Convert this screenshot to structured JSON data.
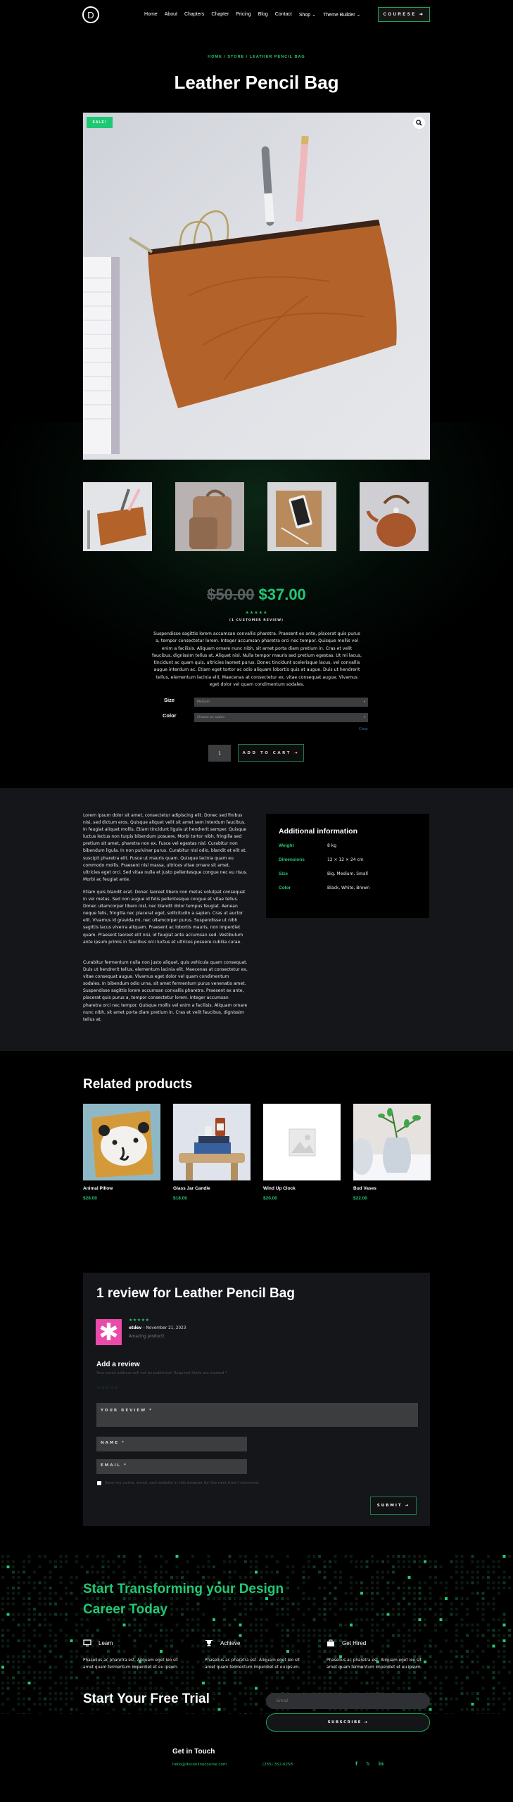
{
  "header": {
    "logo_letter": "D",
    "nav": [
      "Home",
      "About",
      "Chapters",
      "Chapter",
      "Pricing",
      "Blog",
      "Contact",
      "Shop ⌄",
      "Theme Builder ⌄"
    ],
    "course_button": "COURESE ➔"
  },
  "product": {
    "breadcrumb": "HOME / STORE / LEATHER PENCIL BAG",
    "title": "Leather Pencil Bag",
    "sale_badge": "SALE!",
    "zoom_icon": "🔍",
    "thumbnails": [
      "Leather pencil bag",
      "Backpack",
      "Tablet and phone",
      "Copper kettle"
    ],
    "old_price": "$50.00",
    "new_price": "$37.00",
    "rating": 5,
    "rating_stars": "★★★★★",
    "review_count": "(1 CUSTOMER REVIEW)",
    "description": "Suspendisse sagittis lorem accumsan convallis pharetra. Praesent ex ante, placerat quis purus a, tempor consectetur lorem. Integer accumsan pharetra orci nec tempor. Quisque mollis vel enim a facilisis. Aliquam ornare nunc nibh, sit amet porta diam pretium in. Cras et velit faucibus, dignissim tellus at. Aliquet nisl. Nulla tempor mauris sed pretium egestas. Ut mi lacus, tincidunt ac quam quis, ultricies laoreet purus. Donec tincidunt scelerisque lacus, vel convallis augue interdum ac. Etiam eget tortor ac odio aliquam lobortis quis at augue. Duis ut hendrerit tellus, elementum lacinia elit. Maecenas at consectetur ex, vitae consequat augue. Vivamus eget dolor vel quam condimentum sodales.",
    "variations": [
      {
        "label": "Size",
        "value": "Medium"
      },
      {
        "label": "Color",
        "value": "Choose an option"
      }
    ],
    "clear_label": "Clear",
    "quantity": "1",
    "add_to_cart": "ADD TO CART ➔"
  },
  "tabs": {
    "paragraphs": [
      "Lorem ipsum dolor sit amet, consectetur adipiscing elit. Donec sed finibus nisi, sed dictum eros. Quisque aliquet velit sit amet sem interdum faucibus. In feugiat aliquet mollis. Etiam tincidunt ligula ut hendrerit semper. Quisque luctus lectus non turpis bibendum posuere. Morbi tortor nibh, fringilla sed pretium sit amet, pharetra non ex. Fusce vel egestas nisl. Curabitur non bibendum ligula. In non pulvinar purus. Curabitur nisi odio, blandit et elit at, suscipit pharetra elit. Fusce ut mauris quam. Quisque lacinia quam eu commodo mollis. Praesent nisl massa, ultrices vitae ornare sit amet, ultricies eget orci. Sed vitae nulla et justo pellentesque congue nec eu risus. Morbi ac feugiat ante.",
      "Etiam quis blandit erat. Donec laoreet libero non metus volutpat consequat in vel metus. Sed non augue id felis pellentesque congue et vitae tellus. Donec ullamcorper libero nisl, nec blandit dolor tempus feugiat. Aenean neque felis, fringilla nec placerat eget, sollicitudin a sapien. Cras ut auctor elit. Vivamus id gravida mi, nec ullamcorper purus. Suspendisse ut nibh sagittis lacus viverra aliquam. Praesent ac lobortis mauris, non imperdiet quam. Praesent laoreet elit nisi, id feugiat ante accumsan sed. Vestibulum ante ipsum primis in faucibus orci luctus et ultrices posuere cubilia curae.",
      "Curabitur fermentum nulla non justo aliquet, quis vehicula quam consequat. Duis ut hendrerit tellus, elementum lacinia elit. Maecenas at consectetur ex, vitae consequat augue. Vivamus eget dolor vel quam condimentum sodales. In bibendum odio urna, sit amet fermentum purus venenatis amet. Suspendisse sagittis lorem accumsan convallis pharetra. Praesent ex ante, placerat quis purus a, tempor consectetur lorem. Integer accumsan pharetra orci nec tempor. Quisque mollis vel enim a facilisis. Aliquam ornare nunc nibh, sit amet porta diam pretium in. Cras et velit faucibus, dignissim tellus at."
    ],
    "additional_info": {
      "title": "Additional information",
      "rows": [
        {
          "key": "Weight",
          "value": "8 kg"
        },
        {
          "key": "Dimensions",
          "value": "12 × 12 × 24 cm"
        },
        {
          "key": "Size",
          "value": "Big, Medium, Small"
        },
        {
          "key": "Color",
          "value": "Black, White, Brown"
        }
      ]
    }
  },
  "related": {
    "title": "Related products",
    "items": [
      {
        "name": "Animal Pillow",
        "price": "$28.00"
      },
      {
        "name": "Glass Jar Candle",
        "price": "$18.00"
      },
      {
        "name": "Wind Up Clock",
        "price": "$20.00"
      },
      {
        "name": "Bud Vases",
        "price": "$22.00"
      }
    ]
  },
  "reviews": {
    "title": "1 review for Leather Pencil Bag",
    "items": [
      {
        "stars": "★★★★★",
        "author": "etdev",
        "date": "– November 21, 2023",
        "text": "Amazing product!",
        "avatar": "✱"
      }
    ],
    "form": {
      "title": "Add a review",
      "note": "Your email address will not be published. Required fields are marked *",
      "empty_stars": "☆☆☆☆☆",
      "review_label": "YOUR REVIEW *",
      "name_label": "NAME *",
      "email_label": "EMAIL *",
      "consent": "Save my name, email, and website in this browser for the next time I comment.",
      "submit": "SUBMIT ➔"
    }
  },
  "cta": {
    "title": "Start Transforming your Design Career Today",
    "features": [
      {
        "icon": "monitor-icon",
        "glyph": "🖵",
        "title": "Learn",
        "text": "Phasellus ac pharetra est. Aliquam eget leo sit amet quam fermentum imperdiet et eu ipsum."
      },
      {
        "icon": "trophy-icon",
        "glyph": "🏆",
        "title": "Achieve",
        "text": "Phasellus ac pharetra est. Aliquam eget leo sit amet quam fermentum imperdiet et eu ipsum."
      },
      {
        "icon": "briefcase-icon",
        "glyph": "💼",
        "title": "Get Hired",
        "text": "Phasellus ac pharetra est. Aliquam eget leo sit amet quam fermentum imperdiet et eu ipsum."
      }
    ],
    "trial_title": "Start Your Free Trial",
    "email_placeholder": "Email",
    "subscribe": "SUBSCRIBE ➔"
  },
  "footer": {
    "title": "Get in Touch",
    "email": "hello@divionlinecourse.com",
    "phone": "(255) 352-6258",
    "social": [
      "f",
      "𝕏",
      "in"
    ]
  },
  "colors": {
    "accent": "#22c874",
    "accent_border": "#1fa35a",
    "panel": "#141619",
    "avatar": "#ea4aa9"
  }
}
